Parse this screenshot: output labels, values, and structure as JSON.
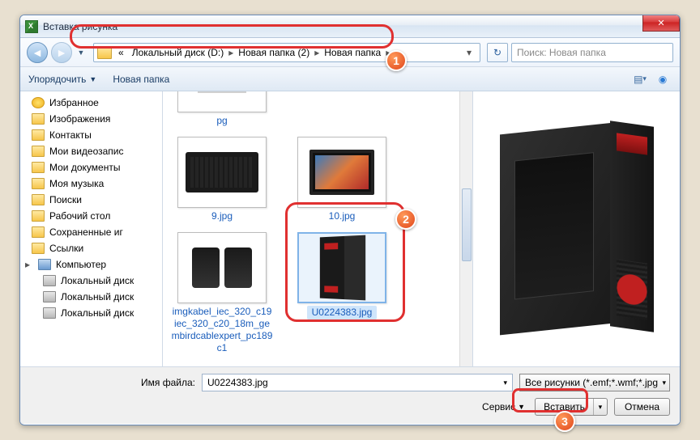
{
  "window": {
    "title": "Вставка рисунка"
  },
  "breadcrumb": {
    "prefix": "«",
    "seg1": "Локальный диск (D:)",
    "seg2": "Новая папка (2)",
    "seg3": "Новая папка"
  },
  "search": {
    "placeholder": "Поиск: Новая папка"
  },
  "toolbar": {
    "organize": "Упорядочить",
    "newfolder": "Новая папка"
  },
  "sidebar": {
    "items": [
      {
        "label": "Избранное",
        "icon": "star",
        "indent": 1
      },
      {
        "label": "Изображения",
        "icon": "folder",
        "indent": 1
      },
      {
        "label": "Контакты",
        "icon": "folder",
        "indent": 1
      },
      {
        "label": "Мои видеозапис",
        "icon": "folder",
        "indent": 1
      },
      {
        "label": "Мои документы",
        "icon": "folder",
        "indent": 1
      },
      {
        "label": "Моя музыка",
        "icon": "folder",
        "indent": 1
      },
      {
        "label": "Поиски",
        "icon": "folder",
        "indent": 1
      },
      {
        "label": "Рабочий стол",
        "icon": "folder",
        "indent": 1
      },
      {
        "label": "Сохраненные иг",
        "icon": "folder",
        "indent": 1
      },
      {
        "label": "Ссылки",
        "icon": "folder",
        "indent": 1
      },
      {
        "label": "Компьютер",
        "icon": "pc",
        "indent": 0
      },
      {
        "label": "Локальный диск",
        "icon": "drive",
        "indent": 1
      },
      {
        "label": "Локальный диск",
        "icon": "drive",
        "indent": 1
      },
      {
        "label": "Локальный диск",
        "icon": "drive",
        "indent": 1
      }
    ]
  },
  "files": {
    "partial_top": "pg",
    "items": [
      {
        "name": "9.jpg",
        "kind": "keyboard"
      },
      {
        "name": "10.jpg",
        "kind": "monitor"
      },
      {
        "name": "imgkabel_iec_320_c19iec_320_c20_18m_gembirdcablexpert_pc189c1",
        "kind": "cable"
      },
      {
        "name": "U0224383.jpg",
        "kind": "tower",
        "selected": true
      }
    ]
  },
  "footer": {
    "filename_label": "Имя файла:",
    "filename_value": "U0224383.jpg",
    "filter": "Все рисунки (*.emf;*.wmf;*.jpg",
    "service": "Сервис",
    "insert": "Вставить",
    "cancel": "Отмена"
  },
  "badges": {
    "b1": "1",
    "b2": "2",
    "b3": "3"
  }
}
